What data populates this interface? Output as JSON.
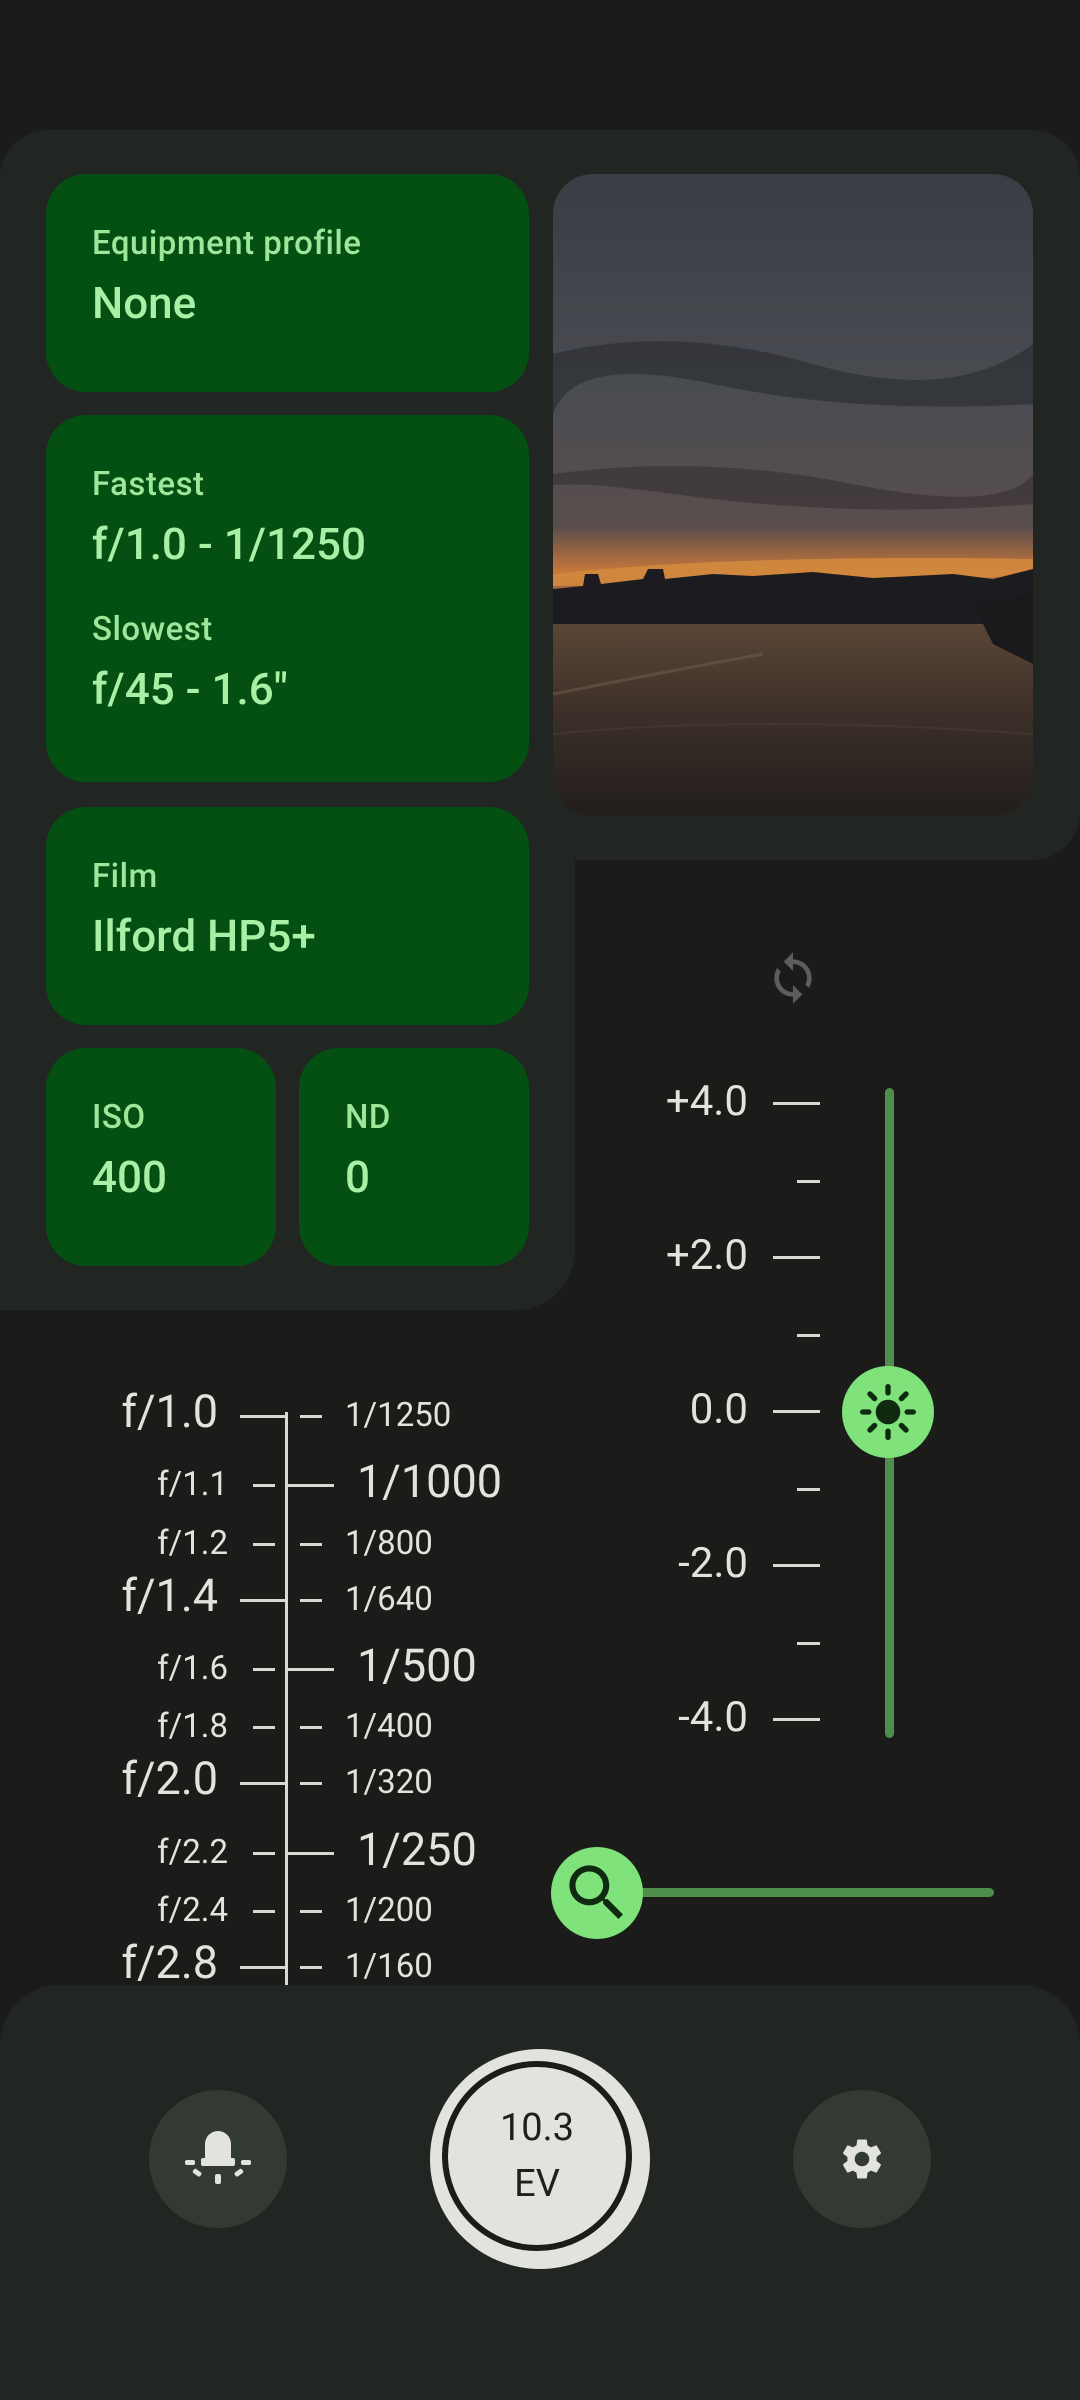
{
  "cards": {
    "equipment": {
      "label": "Equipment profile",
      "value": "None"
    },
    "fastest": {
      "label": "Fastest",
      "value": "f/1.0 - 1/1250"
    },
    "slowest": {
      "label": "Slowest",
      "value": "f/45 - 1.6\""
    },
    "film": {
      "label": "Film",
      "value": "Ilford HP5+"
    },
    "iso": {
      "label": "ISO",
      "value": "400"
    },
    "nd": {
      "label": "ND",
      "value": "0"
    }
  },
  "ev_compensation": {
    "labels": [
      "+4.0",
      "+2.0",
      "0.0",
      "-2.0",
      "-4.0"
    ],
    "value": 0.0,
    "min": -4.0,
    "max": 4.0
  },
  "zoom": {
    "value": 0.0
  },
  "dial": {
    "apertures": [
      {
        "label": "f/1.0",
        "major": true
      },
      {
        "label": "f/1.1",
        "major": false
      },
      {
        "label": "f/1.2",
        "major": false
      },
      {
        "label": "f/1.4",
        "major": true
      },
      {
        "label": "f/1.6",
        "major": false
      },
      {
        "label": "f/1.8",
        "major": false
      },
      {
        "label": "f/2.0",
        "major": true
      },
      {
        "label": "f/2.2",
        "major": false
      },
      {
        "label": "f/2.4",
        "major": false
      },
      {
        "label": "f/2.8",
        "major": true
      }
    ],
    "shutters": [
      {
        "label": "1/1250",
        "major": false
      },
      {
        "label": "1/1000",
        "major": true
      },
      {
        "label": "1/800",
        "major": false
      },
      {
        "label": "1/640",
        "major": false
      },
      {
        "label": "1/500",
        "major": true
      },
      {
        "label": "1/400",
        "major": false
      },
      {
        "label": "1/320",
        "major": false
      },
      {
        "label": "1/250",
        "major": true
      },
      {
        "label": "1/200",
        "major": false
      },
      {
        "label": "1/160",
        "major": false
      }
    ]
  },
  "shutter_button": {
    "value": "10.3",
    "unit": "EV"
  },
  "icons": {
    "sync": "sync-icon",
    "ev": "brightness-icon",
    "zoom": "search-icon",
    "light": "light-meter-icon",
    "settings": "gear-icon"
  },
  "colors": {
    "card_bg": "#035012",
    "accent": "#7fe27a",
    "track": "#4e8e4a",
    "background": "#1b1c1a"
  }
}
